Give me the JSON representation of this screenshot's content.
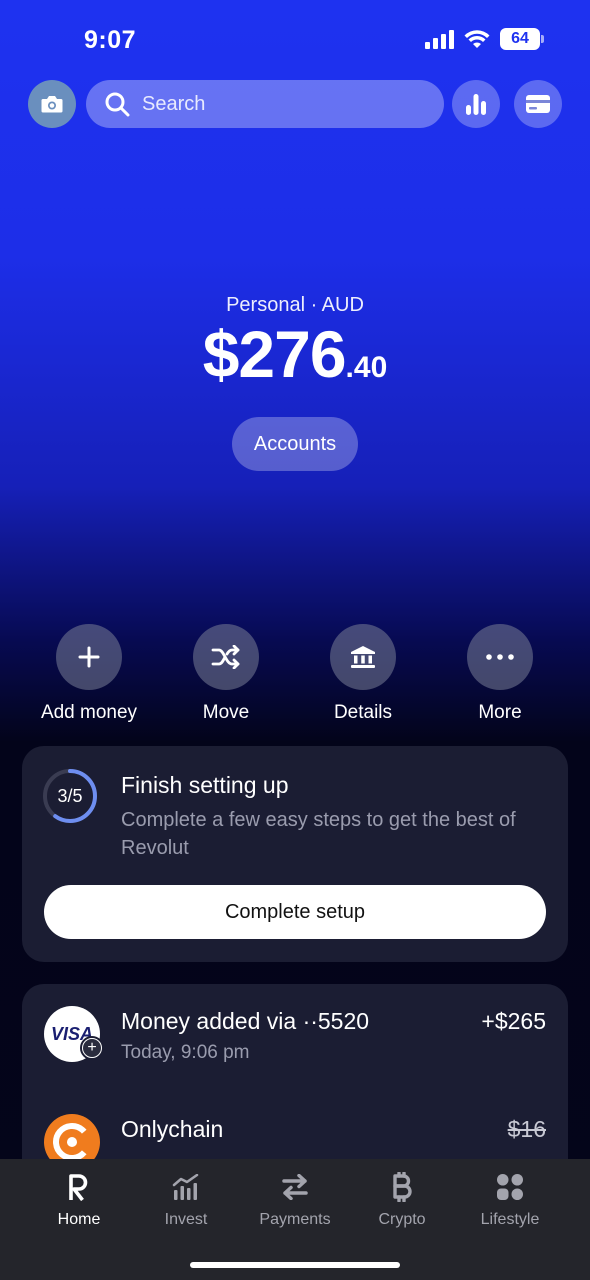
{
  "status": {
    "time": "9:07",
    "battery": "64"
  },
  "search": {
    "placeholder": "Search"
  },
  "balance": {
    "account_label": "Personal · AUD",
    "amount_main": "$276",
    "amount_cents": ".40",
    "accounts_button": "Accounts"
  },
  "actions": [
    {
      "label": "Add money",
      "icon": "plus-icon"
    },
    {
      "label": "Move",
      "icon": "shuffle-icon"
    },
    {
      "label": "Details",
      "icon": "bank-icon"
    },
    {
      "label": "More",
      "icon": "more-icon"
    }
  ],
  "setup": {
    "progress": "3/5",
    "progress_fraction": 0.6,
    "title": "Finish setting up",
    "description": "Complete a few easy steps to get the best of Revolut",
    "button": "Complete setup"
  },
  "transactions": [
    {
      "title": "Money added via ··5520",
      "subtitle": "Today, 9:06 pm",
      "amount": "+$265",
      "logo": "visa-logo",
      "logo_text": "VISA"
    },
    {
      "title": "Onlychain",
      "subtitle": "",
      "amount": "$16",
      "logo": "onlychain-logo"
    }
  ],
  "tabs": [
    {
      "label": "Home",
      "icon": "revolut-r-icon",
      "active": true
    },
    {
      "label": "Invest",
      "icon": "invest-chart-icon"
    },
    {
      "label": "Payments",
      "icon": "transfer-arrows-icon"
    },
    {
      "label": "Crypto",
      "icon": "bitcoin-icon"
    },
    {
      "label": "Lifestyle",
      "icon": "lifestyle-grid-icon"
    }
  ],
  "colors": {
    "accent_blue": "#1e32f0",
    "card_bg": "#1b1d33",
    "tabbar_bg": "#24252b",
    "progress_ring": "#6e8ef0"
  }
}
